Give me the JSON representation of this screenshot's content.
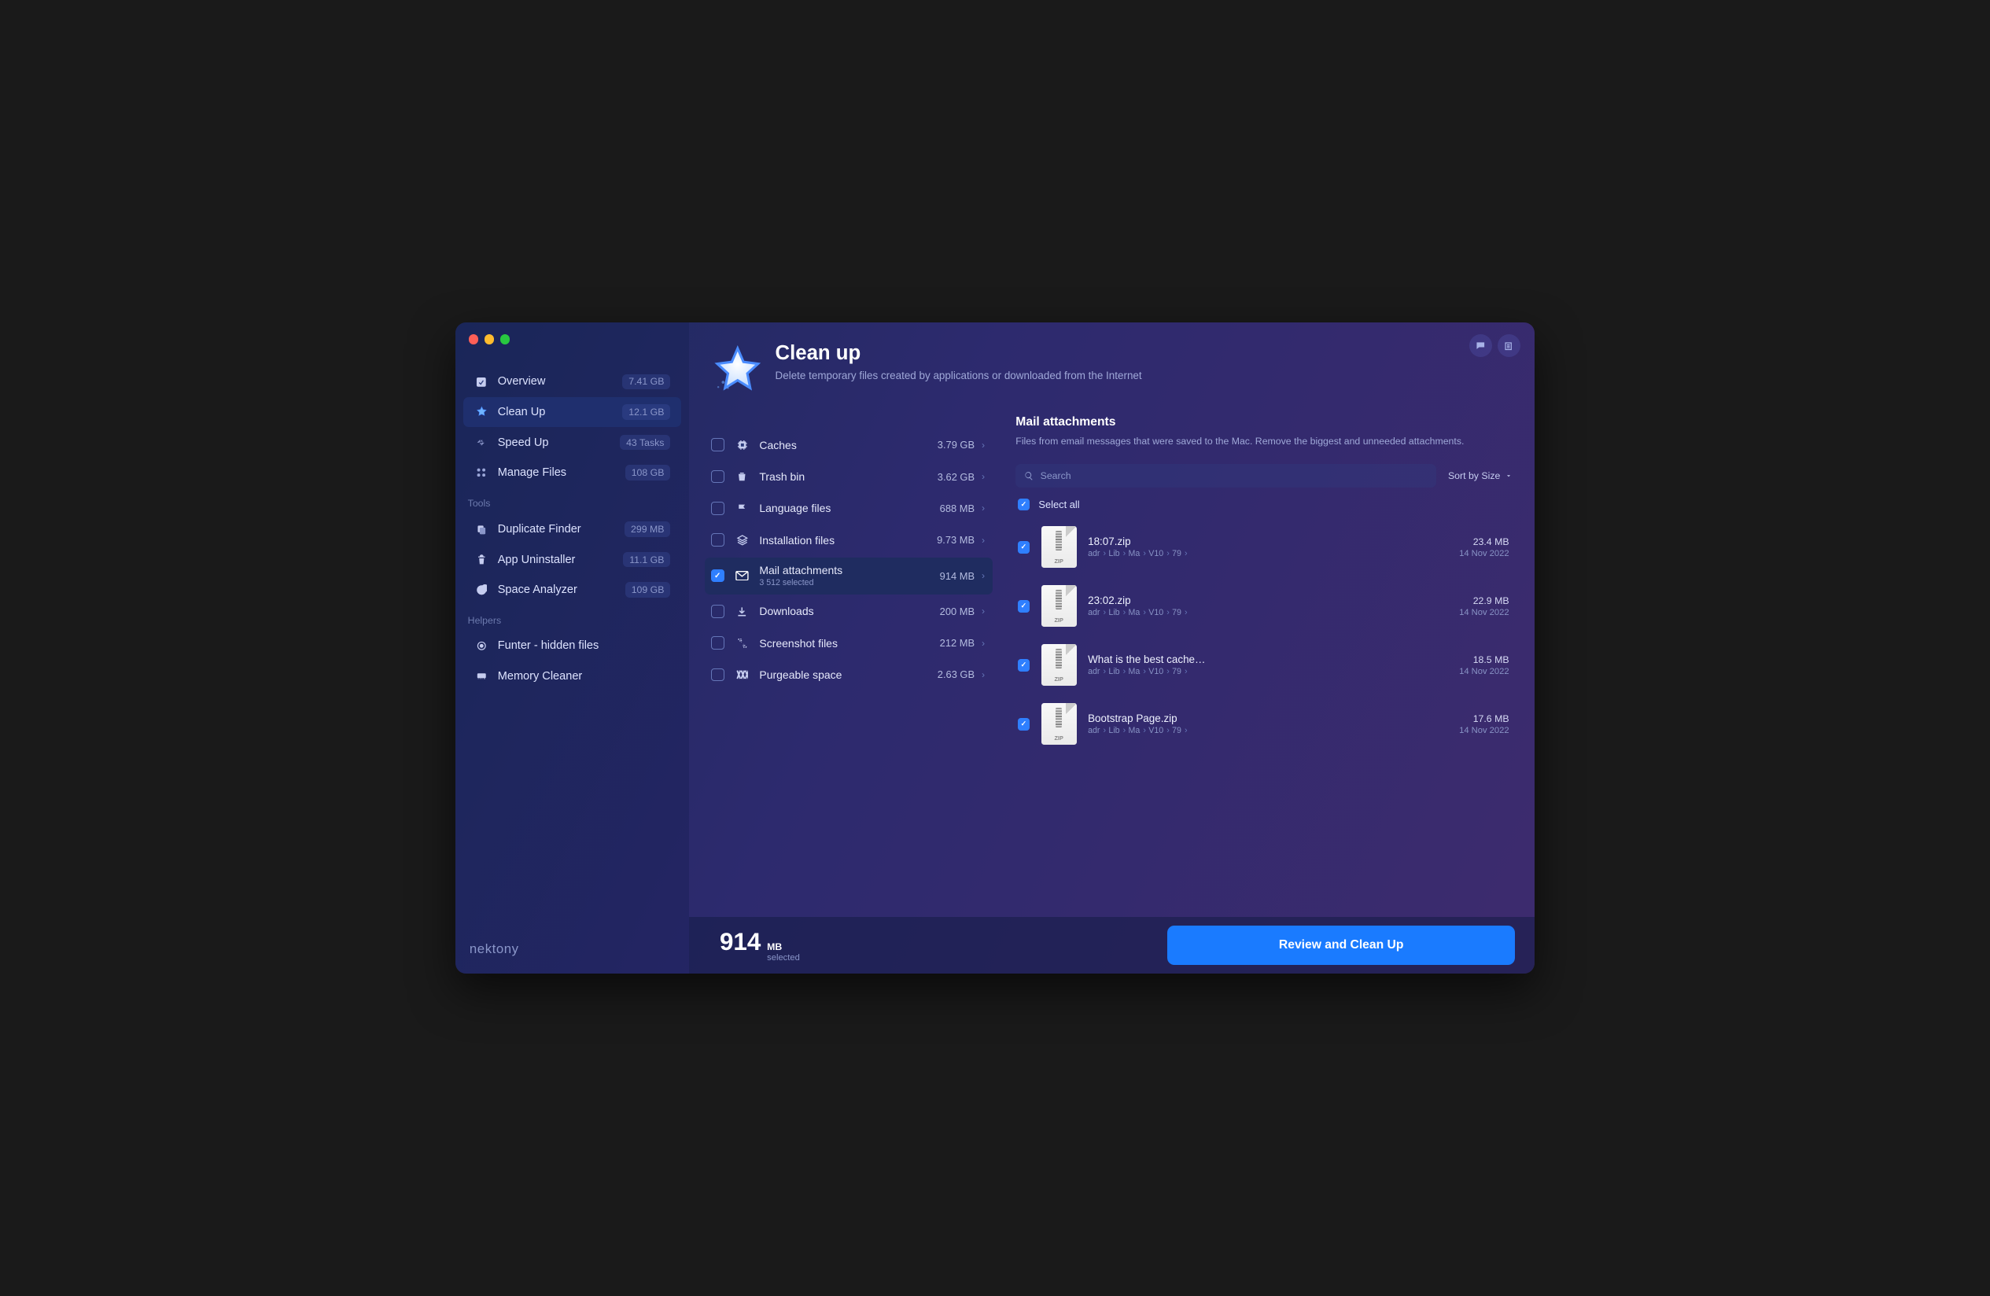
{
  "brand": "nektony",
  "header": {
    "title": "Clean up",
    "subtitle": "Delete temporary files created by applications or downloaded from the Internet"
  },
  "sidebar": {
    "items": [
      {
        "icon": "overview",
        "label": "Overview",
        "stat": "7.41 GB",
        "active": false
      },
      {
        "icon": "cleanup",
        "label": "Clean Up",
        "stat": "12.1 GB",
        "active": true
      },
      {
        "icon": "speedup",
        "label": "Speed Up",
        "stat": "43 Tasks",
        "active": false
      },
      {
        "icon": "manage",
        "label": "Manage Files",
        "stat": "108 GB",
        "active": false
      }
    ],
    "tools_title": "Tools",
    "tools": [
      {
        "icon": "duplicate",
        "label": "Duplicate Finder",
        "stat": "299 MB"
      },
      {
        "icon": "uninstall",
        "label": "App Uninstaller",
        "stat": "11.1 GB"
      },
      {
        "icon": "space",
        "label": "Space Analyzer",
        "stat": "109 GB"
      }
    ],
    "helpers_title": "Helpers",
    "helpers": [
      {
        "icon": "funter",
        "label": "Funter - hidden files"
      },
      {
        "icon": "memory",
        "label": "Memory Cleaner"
      }
    ]
  },
  "categories": [
    {
      "label": "Caches",
      "size": "3.79 GB",
      "checked": false,
      "active": false
    },
    {
      "label": "Trash bin",
      "size": "3.62 GB",
      "checked": false,
      "active": false
    },
    {
      "label": "Language files",
      "size": "688 MB",
      "checked": false,
      "active": false
    },
    {
      "label": "Installation files",
      "size": "9.73 MB",
      "checked": false,
      "active": false
    },
    {
      "label": "Mail attachments",
      "size": "914 MB",
      "sub": "3 512 selected",
      "checked": true,
      "active": true
    },
    {
      "label": "Downloads",
      "size": "200 MB",
      "checked": false,
      "active": false
    },
    {
      "label": "Screenshot files",
      "size": "212 MB",
      "checked": false,
      "active": false
    },
    {
      "label": "Purgeable space",
      "size": "2.63 GB",
      "checked": false,
      "active": false
    }
  ],
  "detail": {
    "title": "Mail attachments",
    "description": "Files from email messages that were saved to the Mac. Remove the biggest and unneeded attachments.",
    "search_placeholder": "Search",
    "sort_label": "Sort by Size",
    "select_all_label": "Select all",
    "path_segments": [
      "adr",
      "Lib",
      "Ma",
      "V10",
      "79"
    ],
    "files": [
      {
        "name": "18:07.zip",
        "size": "23.4 MB",
        "date": "14 Nov 2022",
        "ext": "ZIP"
      },
      {
        "name": "23:02.zip",
        "size": "22.9 MB",
        "date": "14 Nov 2022",
        "ext": "ZIP"
      },
      {
        "name": "What is the best cache…",
        "size": "18.5 MB",
        "date": "14 Nov 2022",
        "ext": "ZIP"
      },
      {
        "name": "Bootstrap Page.zip",
        "size": "17.6 MB",
        "date": "14 Nov 2022",
        "ext": "ZIP"
      }
    ]
  },
  "footer": {
    "total_num": "914",
    "total_unit": "MB",
    "selected_label": "selected",
    "cta_label": "Review and Clean Up"
  }
}
